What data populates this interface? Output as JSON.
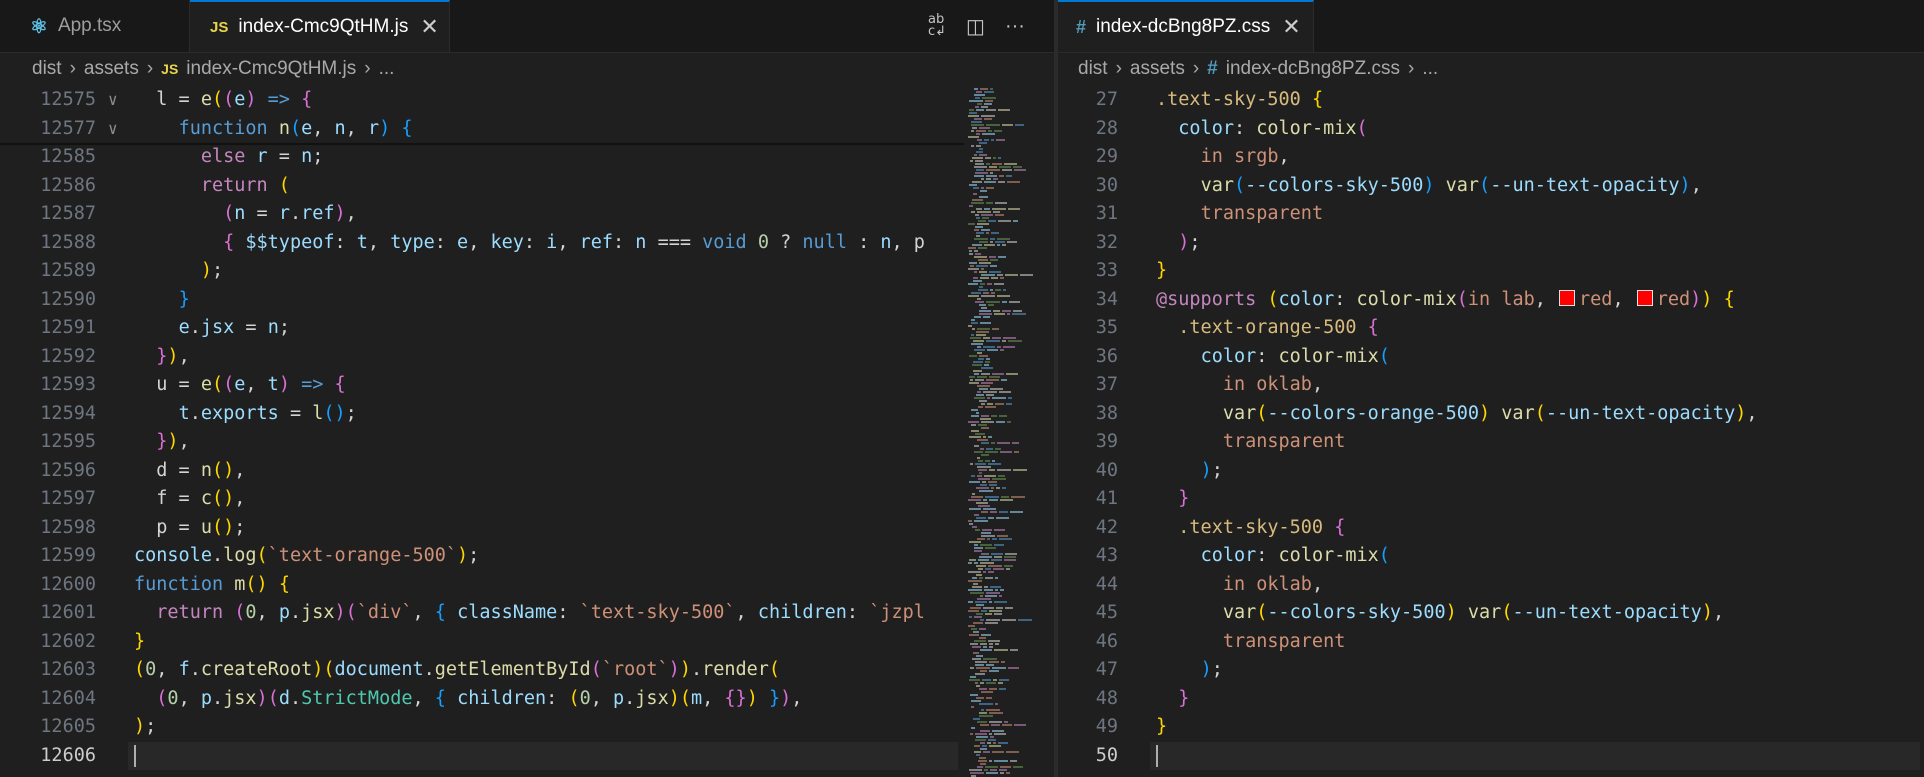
{
  "left": {
    "tabs": [
      {
        "icon": "react-icon",
        "label": "App.tsx",
        "active": false
      },
      {
        "icon": "js-icon",
        "label": "index-Cmc9QtHM.js",
        "active": true,
        "close": "✕"
      }
    ],
    "actions": [
      {
        "name": "compare-icon",
        "glyph": "ab↕"
      },
      {
        "name": "split-editor-icon",
        "glyph": "◫"
      },
      {
        "name": "more-actions-icon",
        "glyph": "···"
      }
    ],
    "breadcrumb": [
      "dist",
      "assets",
      "index-Cmc9QtHM.js",
      "..."
    ],
    "breadcrumb_file_icon": "JS",
    "lines": [
      {
        "num": "12575",
        "fold": "∨",
        "sticky": true
      },
      {
        "num": "12577",
        "fold": "∨",
        "sticky": true
      },
      {
        "num": "12585"
      },
      {
        "num": "12586"
      },
      {
        "num": "12587"
      },
      {
        "num": "12588"
      },
      {
        "num": "12589"
      },
      {
        "num": "12590"
      },
      {
        "num": "12591"
      },
      {
        "num": "12592"
      },
      {
        "num": "12593"
      },
      {
        "num": "12594"
      },
      {
        "num": "12595"
      },
      {
        "num": "12596"
      },
      {
        "num": "12597"
      },
      {
        "num": "12598"
      },
      {
        "num": "12599"
      },
      {
        "num": "12600"
      },
      {
        "num": "12601"
      },
      {
        "num": "12602"
      },
      {
        "num": "12603"
      },
      {
        "num": "12604"
      },
      {
        "num": "12605"
      },
      {
        "num": "12606",
        "current": true
      }
    ],
    "code": [
      [
        [
          "p",
          "  l = "
        ],
        [
          "f",
          "e"
        ],
        [
          "b1",
          "("
        ],
        [
          "b2",
          "("
        ],
        [
          "v",
          "e"
        ],
        [
          "b2",
          ")"
        ],
        [
          "kw",
          " => "
        ],
        [
          "b2",
          "{"
        ]
      ],
      [
        [
          "p",
          "    "
        ],
        [
          "kw",
          "function "
        ],
        [
          "f",
          "n"
        ],
        [
          "b3",
          "("
        ],
        [
          "v",
          "e"
        ],
        [
          "p",
          ", "
        ],
        [
          "v",
          "n"
        ],
        [
          "p",
          ", "
        ],
        [
          "v",
          "r"
        ],
        [
          "b3",
          ")"
        ],
        [
          "p",
          " "
        ],
        [
          "b3",
          "{"
        ]
      ],
      [
        [
          "p",
          "      "
        ],
        [
          "k",
          "else "
        ],
        [
          "v",
          "r"
        ],
        [
          "p",
          " = "
        ],
        [
          "v",
          "n"
        ],
        [
          "p",
          ";"
        ]
      ],
      [
        [
          "p",
          "      "
        ],
        [
          "k",
          "return "
        ],
        [
          "b1",
          "("
        ]
      ],
      [
        [
          "p",
          "        "
        ],
        [
          "b2",
          "("
        ],
        [
          "v",
          "n"
        ],
        [
          "p",
          " = "
        ],
        [
          "v",
          "r"
        ],
        [
          "p",
          "."
        ],
        [
          "v",
          "ref"
        ],
        [
          "b2",
          ")"
        ],
        [
          "p",
          ","
        ]
      ],
      [
        [
          "p",
          "        "
        ],
        [
          "b2",
          "{ "
        ],
        [
          "v",
          "$$typeof"
        ],
        [
          "p",
          ": "
        ],
        [
          "v",
          "t"
        ],
        [
          "p",
          ", "
        ],
        [
          "v",
          "type"
        ],
        [
          "p",
          ": "
        ],
        [
          "v",
          "e"
        ],
        [
          "p",
          ", "
        ],
        [
          "v",
          "key"
        ],
        [
          "p",
          ": "
        ],
        [
          "v",
          "i"
        ],
        [
          "p",
          ", "
        ],
        [
          "v",
          "ref"
        ],
        [
          "p",
          ": "
        ],
        [
          "v",
          "n"
        ],
        [
          "p",
          " === "
        ],
        [
          "kw",
          "void "
        ],
        [
          "n",
          "0"
        ],
        [
          "p",
          " ? "
        ],
        [
          "kw",
          "null"
        ],
        [
          "p",
          " : "
        ],
        [
          "v",
          "n"
        ],
        [
          "p",
          ", p"
        ]
      ],
      [
        [
          "p",
          "      "
        ],
        [
          "b1",
          ")"
        ],
        [
          "p",
          ";"
        ]
      ],
      [
        [
          "p",
          "    "
        ],
        [
          "b3",
          "}"
        ]
      ],
      [
        [
          "p",
          "    "
        ],
        [
          "v",
          "e"
        ],
        [
          "p",
          "."
        ],
        [
          "v",
          "jsx"
        ],
        [
          "p",
          " = "
        ],
        [
          "v",
          "n"
        ],
        [
          "p",
          ";"
        ]
      ],
      [
        [
          "p",
          "  "
        ],
        [
          "b2",
          "}"
        ],
        [
          "b1",
          ")"
        ],
        [
          "p",
          ","
        ]
      ],
      [
        [
          "p",
          "  u = "
        ],
        [
          "f",
          "e"
        ],
        [
          "b1",
          "("
        ],
        [
          "b2",
          "("
        ],
        [
          "v",
          "e"
        ],
        [
          "p",
          ", "
        ],
        [
          "v",
          "t"
        ],
        [
          "b2",
          ")"
        ],
        [
          "kw",
          " => "
        ],
        [
          "b2",
          "{"
        ]
      ],
      [
        [
          "p",
          "    "
        ],
        [
          "v",
          "t"
        ],
        [
          "p",
          "."
        ],
        [
          "v",
          "exports"
        ],
        [
          "p",
          " = "
        ],
        [
          "f",
          "l"
        ],
        [
          "b3",
          "()"
        ],
        [
          "p",
          ";"
        ]
      ],
      [
        [
          "p",
          "  "
        ],
        [
          "b2",
          "}"
        ],
        [
          "b1",
          ")"
        ],
        [
          "p",
          ","
        ]
      ],
      [
        [
          "p",
          "  d = "
        ],
        [
          "f",
          "n"
        ],
        [
          "b1",
          "()"
        ],
        [
          "p",
          ","
        ]
      ],
      [
        [
          "p",
          "  f = "
        ],
        [
          "f",
          "c"
        ],
        [
          "b1",
          "()"
        ],
        [
          "p",
          ","
        ]
      ],
      [
        [
          "p",
          "  p = "
        ],
        [
          "f",
          "u"
        ],
        [
          "b1",
          "()"
        ],
        [
          "p",
          ";"
        ]
      ],
      [
        [
          "v",
          "console"
        ],
        [
          "p",
          "."
        ],
        [
          "f",
          "log"
        ],
        [
          "b1",
          "("
        ],
        [
          "s",
          "`text-orange-500`"
        ],
        [
          "b1",
          ")"
        ],
        [
          "p",
          ";"
        ]
      ],
      [
        [
          "kw",
          "function "
        ],
        [
          "f",
          "m"
        ],
        [
          "b1",
          "()"
        ],
        [
          "p",
          " "
        ],
        [
          "b1",
          "{"
        ]
      ],
      [
        [
          "p",
          "  "
        ],
        [
          "k",
          "return "
        ],
        [
          "b2",
          "("
        ],
        [
          "n",
          "0"
        ],
        [
          "p",
          ", "
        ],
        [
          "v",
          "p"
        ],
        [
          "p",
          "."
        ],
        [
          "f",
          "jsx"
        ],
        [
          "b2",
          ")"
        ],
        [
          "b2",
          "("
        ],
        [
          "s",
          "`div`"
        ],
        [
          "p",
          ", "
        ],
        [
          "b3",
          "{ "
        ],
        [
          "v",
          "className"
        ],
        [
          "p",
          ": "
        ],
        [
          "s",
          "`text-sky-500`"
        ],
        [
          "p",
          ", "
        ],
        [
          "v",
          "children"
        ],
        [
          "p",
          ": "
        ],
        [
          "s",
          "`jzpl"
        ]
      ],
      [
        [
          "b1",
          "}"
        ]
      ],
      [
        [
          "b1",
          "("
        ],
        [
          "n",
          "0"
        ],
        [
          "p",
          ", "
        ],
        [
          "v",
          "f"
        ],
        [
          "p",
          "."
        ],
        [
          "f",
          "createRoot"
        ],
        [
          "b1",
          ")"
        ],
        [
          "b1",
          "("
        ],
        [
          "v",
          "document"
        ],
        [
          "p",
          "."
        ],
        [
          "f",
          "getElementById"
        ],
        [
          "b2",
          "("
        ],
        [
          "s",
          "`root`"
        ],
        [
          "b2",
          ")"
        ],
        [
          "b1",
          ")"
        ],
        [
          "p",
          "."
        ],
        [
          "f",
          "render"
        ],
        [
          "b1",
          "("
        ]
      ],
      [
        [
          "p",
          "  "
        ],
        [
          "b2",
          "("
        ],
        [
          "n",
          "0"
        ],
        [
          "p",
          ", "
        ],
        [
          "v",
          "p"
        ],
        [
          "p",
          "."
        ],
        [
          "f",
          "jsx"
        ],
        [
          "b2",
          ")"
        ],
        [
          "b2",
          "("
        ],
        [
          "v",
          "d"
        ],
        [
          "p",
          "."
        ],
        [
          "t",
          "StrictMode"
        ],
        [
          "p",
          ", "
        ],
        [
          "b3",
          "{ "
        ],
        [
          "v",
          "children"
        ],
        [
          "p",
          ": "
        ],
        [
          "b1",
          "("
        ],
        [
          "n",
          "0"
        ],
        [
          "p",
          ", "
        ],
        [
          "v",
          "p"
        ],
        [
          "p",
          "."
        ],
        [
          "f",
          "jsx"
        ],
        [
          "b1",
          ")"
        ],
        [
          "b1",
          "("
        ],
        [
          "v",
          "m"
        ],
        [
          "p",
          ", "
        ],
        [
          "b2",
          "{}"
        ],
        [
          "b1",
          ")"
        ],
        [
          "b3",
          " }"
        ],
        [
          "b2",
          ")"
        ],
        [
          "p",
          ","
        ]
      ],
      [
        [
          "b1",
          ")"
        ],
        [
          "p",
          ";"
        ]
      ],
      []
    ]
  },
  "right": {
    "tabs": [
      {
        "icon": "css-hash-icon",
        "label": "index-dcBng8PZ.css",
        "active": true,
        "close": "✕"
      }
    ],
    "breadcrumb": [
      "dist",
      "assets",
      "index-dcBng8PZ.css",
      "..."
    ],
    "breadcrumb_file_icon": "#",
    "lines": [
      {
        "num": "27"
      },
      {
        "num": "28"
      },
      {
        "num": "29"
      },
      {
        "num": "30"
      },
      {
        "num": "31"
      },
      {
        "num": "32"
      },
      {
        "num": "33"
      },
      {
        "num": "34"
      },
      {
        "num": "35"
      },
      {
        "num": "36"
      },
      {
        "num": "37"
      },
      {
        "num": "38"
      },
      {
        "num": "39"
      },
      {
        "num": "40"
      },
      {
        "num": "41"
      },
      {
        "num": "42"
      },
      {
        "num": "43"
      },
      {
        "num": "44"
      },
      {
        "num": "45"
      },
      {
        "num": "46"
      },
      {
        "num": "47"
      },
      {
        "num": "48"
      },
      {
        "num": "49"
      },
      {
        "num": "50",
        "current": true
      }
    ],
    "code": [
      [
        [
          "sel",
          ".text-sky-500"
        ],
        [
          "p",
          " "
        ],
        [
          "b1",
          "{"
        ]
      ],
      [
        [
          "p",
          "  "
        ],
        [
          "pr",
          "color"
        ],
        [
          "p",
          ": "
        ],
        [
          "cf",
          "color-mix"
        ],
        [
          "b2",
          "("
        ]
      ],
      [
        [
          "p",
          "    "
        ],
        [
          "s",
          "in srgb"
        ],
        [
          "p",
          ","
        ]
      ],
      [
        [
          "p",
          "    "
        ],
        [
          "cf",
          "var"
        ],
        [
          "b3",
          "("
        ],
        [
          "v",
          "--colors-sky-500"
        ],
        [
          "b3",
          ")"
        ],
        [
          "p",
          " "
        ],
        [
          "cf",
          "var"
        ],
        [
          "b3",
          "("
        ],
        [
          "v",
          "--un-text-opacity"
        ],
        [
          "b3",
          ")"
        ],
        [
          "p",
          ","
        ]
      ],
      [
        [
          "p",
          "    "
        ],
        [
          "s",
          "transparent"
        ]
      ],
      [
        [
          "p",
          "  "
        ],
        [
          "b2",
          ")"
        ],
        [
          "p",
          ";"
        ]
      ],
      [
        [
          "b1",
          "}"
        ]
      ],
      [
        [
          "k",
          "@supports"
        ],
        [
          "p",
          " "
        ],
        [
          "b1",
          "("
        ],
        [
          "pr",
          "color"
        ],
        [
          "p",
          ": "
        ],
        [
          "cf",
          "color-mix"
        ],
        [
          "b2",
          "("
        ],
        [
          "s",
          "in lab"
        ],
        [
          "p",
          ", "
        ],
        [
          "SW",
          ""
        ],
        [
          "s",
          "red"
        ],
        [
          "p",
          ", "
        ],
        [
          "SW",
          ""
        ],
        [
          "s",
          "red"
        ],
        [
          "b2",
          ")"
        ],
        [
          "b1",
          ")"
        ],
        [
          "p",
          " "
        ],
        [
          "b1",
          "{"
        ]
      ],
      [
        [
          "p",
          "  "
        ],
        [
          "sel",
          ".text-orange-500"
        ],
        [
          "p",
          " "
        ],
        [
          "b2",
          "{"
        ]
      ],
      [
        [
          "p",
          "    "
        ],
        [
          "pr",
          "color"
        ],
        [
          "p",
          ": "
        ],
        [
          "cf",
          "color-mix"
        ],
        [
          "b3",
          "("
        ]
      ],
      [
        [
          "p",
          "      "
        ],
        [
          "s",
          "in oklab"
        ],
        [
          "p",
          ","
        ]
      ],
      [
        [
          "p",
          "      "
        ],
        [
          "cf",
          "var"
        ],
        [
          "b1",
          "("
        ],
        [
          "v",
          "--colors-orange-500"
        ],
        [
          "b1",
          ")"
        ],
        [
          "p",
          " "
        ],
        [
          "cf",
          "var"
        ],
        [
          "b1",
          "("
        ],
        [
          "v",
          "--un-text-opacity"
        ],
        [
          "b1",
          ")"
        ],
        [
          "p",
          ","
        ]
      ],
      [
        [
          "p",
          "      "
        ],
        [
          "s",
          "transparent"
        ]
      ],
      [
        [
          "p",
          "    "
        ],
        [
          "b3",
          ")"
        ],
        [
          "p",
          ";"
        ]
      ],
      [
        [
          "p",
          "  "
        ],
        [
          "b2",
          "}"
        ]
      ],
      [
        [
          "p",
          "  "
        ],
        [
          "sel",
          ".text-sky-500"
        ],
        [
          "p",
          " "
        ],
        [
          "b2",
          "{"
        ]
      ],
      [
        [
          "p",
          "    "
        ],
        [
          "pr",
          "color"
        ],
        [
          "p",
          ": "
        ],
        [
          "cf",
          "color-mix"
        ],
        [
          "b3",
          "("
        ]
      ],
      [
        [
          "p",
          "      "
        ],
        [
          "s",
          "in oklab"
        ],
        [
          "p",
          ","
        ]
      ],
      [
        [
          "p",
          "      "
        ],
        [
          "cf",
          "var"
        ],
        [
          "b1",
          "("
        ],
        [
          "v",
          "--colors-sky-500"
        ],
        [
          "b1",
          ")"
        ],
        [
          "p",
          " "
        ],
        [
          "cf",
          "var"
        ],
        [
          "b1",
          "("
        ],
        [
          "v",
          "--un-text-opacity"
        ],
        [
          "b1",
          ")"
        ],
        [
          "p",
          ","
        ]
      ],
      [
        [
          "p",
          "      "
        ],
        [
          "s",
          "transparent"
        ]
      ],
      [
        [
          "p",
          "    "
        ],
        [
          "b3",
          ")"
        ],
        [
          "p",
          ";"
        ]
      ],
      [
        [
          "p",
          "  "
        ],
        [
          "b2",
          "}"
        ]
      ],
      [
        [
          "b1",
          "}"
        ]
      ],
      []
    ]
  },
  "colors": {
    "accent": "#0078d4",
    "editor_bg": "#1f1f1f",
    "tabbar_bg": "#181818",
    "color_swatch": "#ff0000"
  }
}
